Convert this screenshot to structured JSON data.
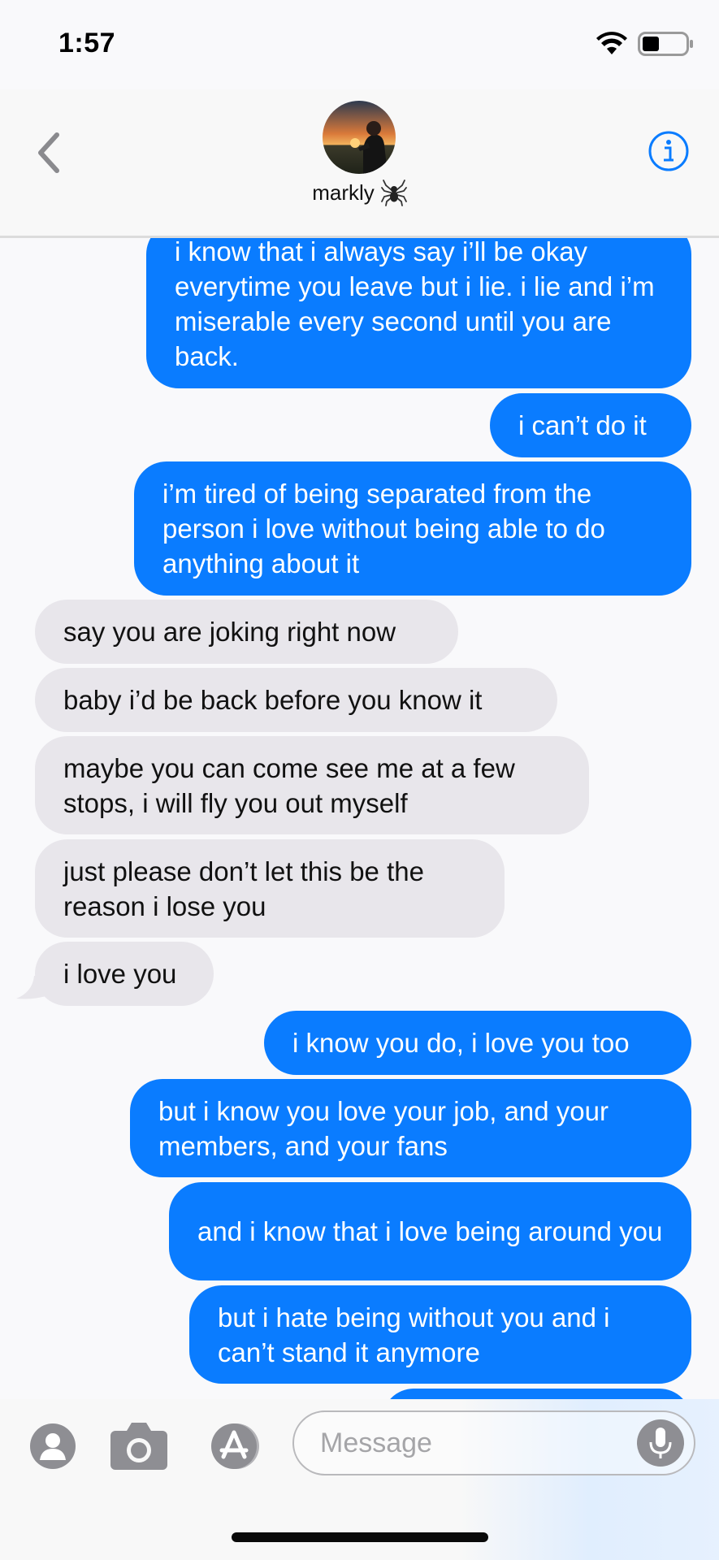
{
  "status_bar": {
    "time": "1:57",
    "wifi_icon": "wifi-icon",
    "battery_icon": "battery-icon"
  },
  "header": {
    "back_icon": "chevron-left-icon",
    "contact_name": "markly",
    "name_emoji": "🕷️",
    "info_icon": "info-icon"
  },
  "messages": [
    {
      "from": "me",
      "text": "i know that i always say i’ll be okay everytime you leave but i lie. i lie and i’m miserable every second until you are back."
    },
    {
      "from": "me",
      "text": "i can’t do it"
    },
    {
      "from": "me",
      "text": "i’m tired of being separated from the person i love without being able to do anything about it"
    },
    {
      "from": "them",
      "text": "say you are joking right now"
    },
    {
      "from": "them",
      "text": "baby i’d be back before you know it"
    },
    {
      "from": "them",
      "text": "maybe you can come see me at a few stops, i will fly you out myself"
    },
    {
      "from": "them",
      "text": "just please don’t let this be the reason i lose you"
    },
    {
      "from": "them",
      "text": "i love you"
    },
    {
      "from": "me",
      "text": "i know you do, i love you too"
    },
    {
      "from": "me",
      "text": "but i know you love your job, and your members, and your fans"
    },
    {
      "from": "me",
      "text": "and i know that i love being around you"
    },
    {
      "from": "me",
      "text": "but i hate being without you and i can’t stand it anymore"
    }
  ],
  "composer": {
    "placeholder": "Message",
    "icons": [
      "contacts-icon",
      "camera-icon",
      "app-store-icon",
      "microphone-icon"
    ]
  },
  "colors": {
    "sent_bubble": "#0a7cff",
    "received_bubble": "#e8e6eb",
    "accent": "#0a7cff"
  }
}
